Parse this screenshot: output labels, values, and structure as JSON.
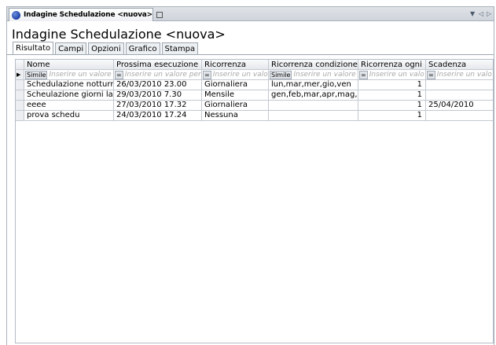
{
  "document_tab": {
    "label": "Indagine Schedulazione <nuova>"
  },
  "title": "Indagine Schedulazione <nuova>",
  "tabs": [
    {
      "label": "Risultato"
    },
    {
      "label": "Campi"
    },
    {
      "label": "Opzioni"
    },
    {
      "label": "Grafico"
    },
    {
      "label": "Stampa"
    }
  ],
  "grid": {
    "columns": [
      "Nome",
      "Prossima esecuzione",
      "Ricorrenza",
      "Ricorrenza condizione",
      "Ricorrenza ogni",
      "Scadenza"
    ],
    "filter": [
      {
        "op": "Simile",
        "placeholder": "Inserire un valore p"
      },
      {
        "op": "=",
        "placeholder": "Inserire un valore per"
      },
      {
        "op": "=",
        "placeholder": "Inserire un valo"
      },
      {
        "op": "Simile",
        "placeholder": "Inserire un valore p"
      },
      {
        "op": "=",
        "placeholder": "Inserire un valo"
      },
      {
        "op": "=",
        "placeholder": "Inserire un valo"
      }
    ],
    "rows": [
      [
        "Schedulazione notturn",
        "26/03/2010 23.00",
        "Giornaliera",
        "lun,mar,mer,gio,ven",
        "1",
        ""
      ],
      [
        "Scheulazione giorni lav",
        "29/03/2010 7.30",
        "Mensile",
        "gen,feb,mar,apr,mag,g",
        "1",
        ""
      ],
      [
        "eeee",
        "27/03/2010 17.32",
        "Giornaliera",
        "",
        "1",
        "25/04/2010"
      ],
      [
        "prova schedu",
        "24/03/2010 17.24",
        "Nessuna",
        "",
        "1",
        ""
      ]
    ]
  }
}
